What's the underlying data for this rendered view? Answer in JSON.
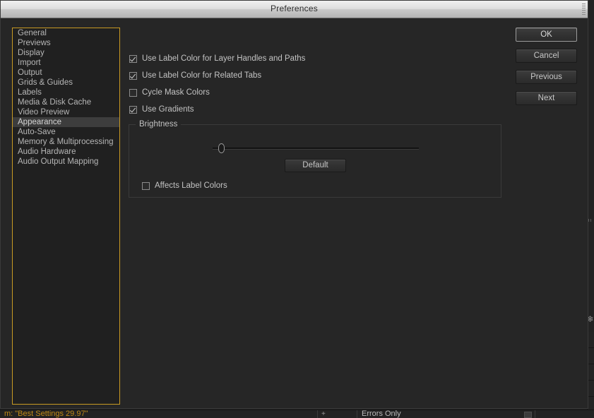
{
  "window": {
    "title": "Preferences"
  },
  "sidebar": {
    "name": "preference-categories",
    "selected": "Appearance",
    "items": [
      {
        "label": "General"
      },
      {
        "label": "Previews"
      },
      {
        "label": "Display"
      },
      {
        "label": "Import"
      },
      {
        "label": "Output"
      },
      {
        "label": "Grids & Guides"
      },
      {
        "label": "Labels"
      },
      {
        "label": "Media & Disk Cache"
      },
      {
        "label": "Video Preview"
      },
      {
        "label": "Appearance"
      },
      {
        "label": "Auto-Save"
      },
      {
        "label": "Memory & Multiprocessing"
      },
      {
        "label": "Audio Hardware"
      },
      {
        "label": "Audio Output Mapping"
      }
    ]
  },
  "main": {
    "checkboxes": [
      {
        "label": "Use Label Color for Layer Handles and Paths",
        "checked": true
      },
      {
        "label": "Use Label Color for Related Tabs",
        "checked": true
      },
      {
        "label": "Cycle Mask Colors",
        "checked": false
      },
      {
        "label": "Use Gradients",
        "checked": true
      }
    ],
    "brightness": {
      "group_label": "Brightness",
      "slider_value_percent": 3,
      "default_button_label": "Default",
      "affects_label_colors": {
        "label": "Affects Label Colors",
        "checked": false
      }
    }
  },
  "buttons": {
    "ok": "OK",
    "cancel": "Cancel",
    "previous": "Previous",
    "next": "Next"
  },
  "background_app": {
    "render_settings_text": "m: \"Best Settings 29.97\"",
    "plus_label": "+",
    "log_dropdown": "Errors Only"
  },
  "colors": {
    "dialog_bg": "#262626",
    "focus_border": "#c89a23",
    "selected_row": "#3d3d3d",
    "accent_text": "#c08a16"
  }
}
